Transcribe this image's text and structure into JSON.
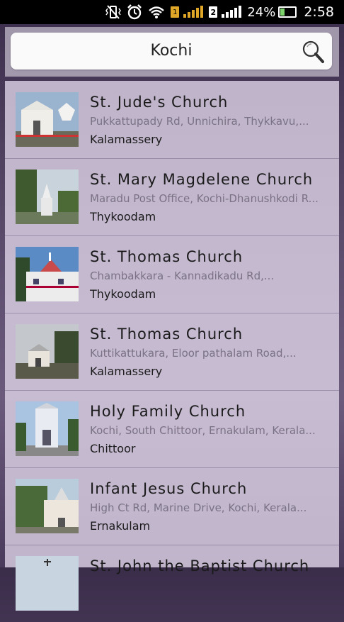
{
  "status_bar": {
    "sim1_label": "1",
    "sim2_label": "2",
    "battery": "24%",
    "time": "2:58",
    "icons": [
      "vibrate-icon",
      "alarm-icon",
      "wifi-icon",
      "sim1-signal-icon",
      "sim2-signal-icon",
      "battery-icon"
    ]
  },
  "search": {
    "query": "Kochi",
    "icon": "search-icon"
  },
  "churches": [
    {
      "name": "St. Jude's Church",
      "address": "Pukkattupady Rd, Unnichira, Thykkavu,...",
      "area": "Kalamassery",
      "thumb": "church-photo-1"
    },
    {
      "name": "St. Mary Magdelene Church",
      "address": " Maradu Post Office, Kochi-Dhanushkodi R...",
      "area": "Thykoodam",
      "thumb": "church-photo-2"
    },
    {
      "name": "St. Thomas Church",
      "address": "Chambakkara - Kannadikadu Rd,...",
      "area": "Thykoodam",
      "thumb": "church-photo-3"
    },
    {
      "name": "St. Thomas Church",
      "address": "Kuttikattukara, Eloor pathalam Road,...",
      "area": "Kalamassery",
      "thumb": "church-photo-4"
    },
    {
      "name": "Holy Family Church",
      "address": "Kochi, South Chittoor, Ernakulam, Kerala...",
      "area": "Chittoor",
      "thumb": "church-photo-5"
    },
    {
      "name": "Infant Jesus Church",
      "address": "High Ct Rd, Marine Drive, Kochi, Kerala...",
      "area": "Ernakulam",
      "thumb": "church-photo-6"
    },
    {
      "name": "St. John the Baptist Church",
      "address": "",
      "area": "",
      "thumb": "church-photo-7"
    }
  ]
}
